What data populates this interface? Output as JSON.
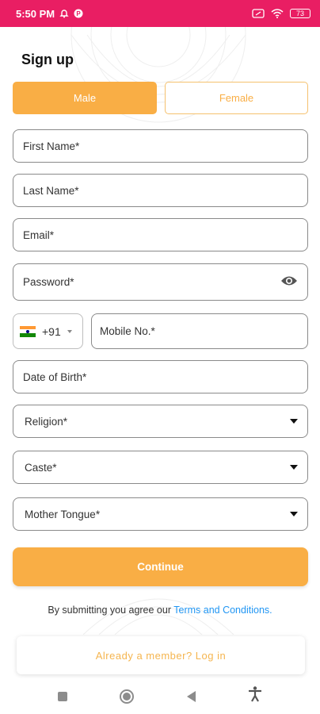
{
  "status_bar": {
    "time": "5:50 PM",
    "battery": "73",
    "icons": [
      "alarm-icon",
      "app-notification-icon",
      "sim-icon",
      "wifi-icon",
      "battery-icon"
    ],
    "color": "#E91E63"
  },
  "form": {
    "title": "Sign up",
    "gender": {
      "male_label": "Male",
      "female_label": "Female",
      "selected": "Male"
    },
    "fields": {
      "first_name": "First Name*",
      "last_name": "Last Name*",
      "email": "Email*",
      "password": "Password*",
      "country_code": "+91",
      "mobile": "Mobile No.*",
      "dob": "Date of Birth*",
      "religion": "Religion*",
      "caste": "Caste*",
      "mother_tongue": "Mother Tongue*"
    },
    "continue_label": "Continue",
    "agree_text": "By submitting you agree our ",
    "terms_link": "Terms and Conditions.",
    "login_label": "Already a member? Log in"
  },
  "colors": {
    "accent": "#F9AE45",
    "link": "#2196F3",
    "field_border": "#8a8a8a"
  },
  "nav": {
    "icons": [
      "recents-icon",
      "home-icon",
      "back-icon",
      "accessibility-icon"
    ]
  }
}
